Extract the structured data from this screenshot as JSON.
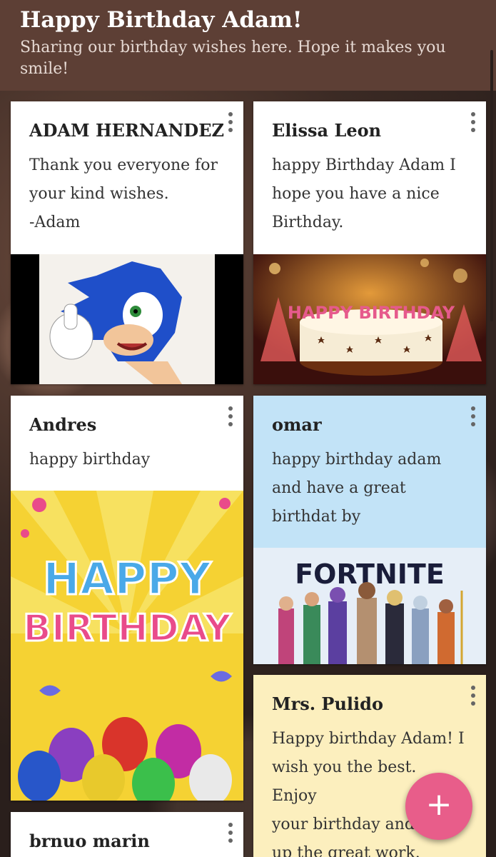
{
  "header": {
    "title": "Happy Birthday Adam!",
    "subtitle": "Sharing our birthday wishes here. Hope it makes you smile!"
  },
  "posts": [
    {
      "author": "ADAM HERNANDEZ",
      "message_lines": [
        "Thank you everyone for",
        "your kind wishes.",
        "-Adam"
      ],
      "image": "sonic-thumbs-up"
    },
    {
      "author": "Elissa Leon",
      "message_lines": [
        "happy Birthday Adam I",
        "hope you have a nice",
        "Birthday."
      ],
      "image": "birthday-cake-candles",
      "image_text": "HAPPY BIRTHDAY"
    },
    {
      "author": "Andres",
      "message_lines": [
        "happy birthday"
      ],
      "image": "happy-birthday-balloons",
      "image_text_1": "HAPPY",
      "image_text_2": "BIRTHDAY"
    },
    {
      "author": "omar",
      "message_lines": [
        "happy birthday adam",
        "and have a great",
        "birthdat by"
      ],
      "image": "fortnite-characters",
      "image_text": "FORTNITE",
      "card_color": "#c2e3f7"
    },
    {
      "author": "Mrs. Pulido",
      "message_lines": [
        "Happy birthday Adam! I",
        "wish you the best. Enjoy",
        "your birthday and keep",
        "up the great work."
      ],
      "card_color": "#fcefbe"
    },
    {
      "author": "brnuo marin"
    }
  ],
  "fab": {
    "icon": "plus-icon",
    "label": "+"
  },
  "colors": {
    "header": "#5d3f35",
    "fab": "#e85d8a"
  }
}
